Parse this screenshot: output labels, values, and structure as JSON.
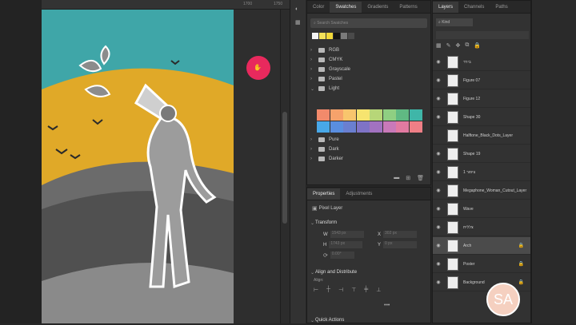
{
  "ruler": {
    "tick_labels": [
      "1700",
      "1750"
    ]
  },
  "swatches_panel": {
    "tabs": [
      "Color",
      "Swatches",
      "Gradients",
      "Patterns"
    ],
    "active_tab": "Swatches",
    "search_placeholder": "Search Swatches",
    "recent_colors": [
      "#f4f4f4",
      "#f3e25a",
      "#f2d93a",
      "#151515",
      "#7a7a7a",
      "#4a4a4a"
    ],
    "groups": [
      {
        "name": "RGB",
        "open": false
      },
      {
        "name": "CMYK",
        "open": false
      },
      {
        "name": "Grayscale",
        "open": false
      },
      {
        "name": "Pastel",
        "open": false
      },
      {
        "name": "Light",
        "open": true
      },
      {
        "name": "Pure",
        "open": false
      },
      {
        "name": "Dark",
        "open": false
      },
      {
        "name": "Darker",
        "open": false
      }
    ],
    "light_colors": [
      "#f28a6b",
      "#f6a26b",
      "#f8c56d",
      "#f6e46f",
      "#b7d678",
      "#8fcf82",
      "#60b983",
      "#3fb6a8",
      "#48a8e8",
      "#5a8ee0",
      "#6a7fd0",
      "#7f73c6",
      "#a272c0",
      "#c979b9",
      "#e27aa1",
      "#ef7f86"
    ]
  },
  "properties_panel": {
    "tabs": [
      "Properties",
      "Adjustments"
    ],
    "active_tab": "Properties",
    "layer_kind": "Pixel Layer",
    "transform_title": "Transform",
    "transform_fields": [
      {
        "label": "W",
        "value": "1543 px"
      },
      {
        "label": "H",
        "value": "1743 px"
      },
      {
        "label": "X",
        "value": "302 px"
      },
      {
        "label": "Y",
        "value": "0 px"
      },
      {
        "label": "",
        "value": "0.00°"
      }
    ],
    "align_title": "Align and Distribute",
    "align_label": "Align:",
    "quick_actions_title": "Quick Actions"
  },
  "layers_panel": {
    "tabs": [
      "Layers",
      "Channels",
      "Paths"
    ],
    "active_tab": "Layers",
    "kind_filter": "Kind",
    "layers": [
      {
        "name": "בירד",
        "visible": true,
        "selected": false,
        "locked": false
      },
      {
        "name": "Figure 07",
        "visible": true,
        "selected": false,
        "locked": false
      },
      {
        "name": "Figure 12",
        "visible": true,
        "selected": false,
        "locked": false
      },
      {
        "name": "Shape 30",
        "visible": true,
        "selected": false,
        "locked": false
      },
      {
        "name": "Halftone_Black_Dots_Layer",
        "visible": false,
        "selected": false,
        "locked": false
      },
      {
        "name": "Shape 19",
        "visible": true,
        "selected": false,
        "locked": false
      },
      {
        "name": "ציפור 1",
        "visible": true,
        "selected": false,
        "locked": false
      },
      {
        "name": "Megaphone_Woman_Cutout_Layer",
        "visible": true,
        "selected": false,
        "locked": false
      },
      {
        "name": "Wave",
        "visible": true,
        "selected": false,
        "locked": false
      },
      {
        "name": "צללית",
        "visible": true,
        "selected": false,
        "locked": false
      },
      {
        "name": "Arch",
        "visible": true,
        "selected": true,
        "locked": true
      },
      {
        "name": "Poster",
        "visible": true,
        "selected": false,
        "locked": true
      },
      {
        "name": "Background",
        "visible": true,
        "selected": false,
        "locked": true
      }
    ]
  },
  "watermark": {
    "text": "SA"
  },
  "colors": {
    "accent_cursor": "#e8295d",
    "teal": "#3fa6a8",
    "mustard": "#e0a928"
  }
}
